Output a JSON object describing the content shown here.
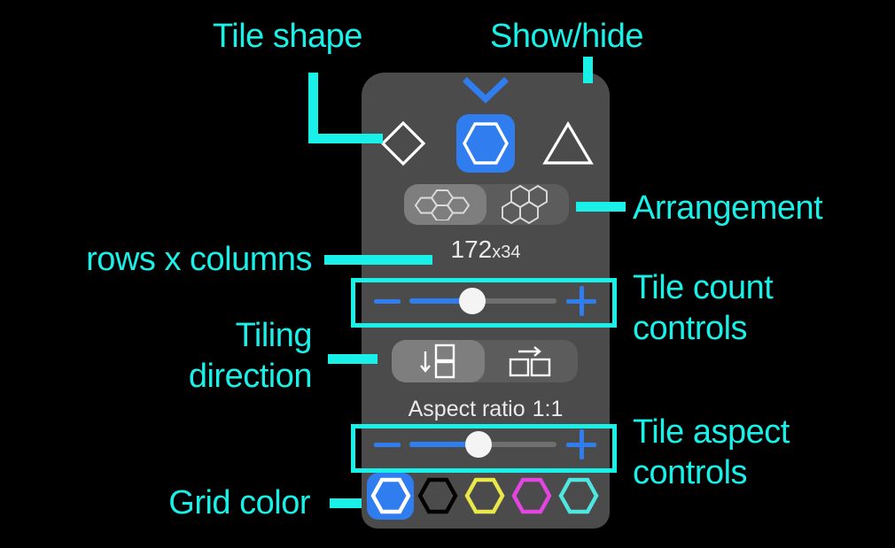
{
  "theme": {
    "background": "#000000",
    "panel_bg": "#4b4b4b",
    "segment_bg": "#5c5c5c",
    "segment_selected_bg": "#7e7e7e",
    "accent_blue": "#2f7def",
    "annotation_cyan": "#18f0e8",
    "text_white": "#e9e9e9"
  },
  "annotations": [
    {
      "id": "tile-shape",
      "label": "Tile shape"
    },
    {
      "id": "show-hide",
      "label": "Show/hide"
    },
    {
      "id": "arrangement",
      "label": "Arrangement"
    },
    {
      "id": "rows-columns",
      "label": "rows x columns"
    },
    {
      "id": "tile-count",
      "label": "Tile count\ncontrols"
    },
    {
      "id": "tiling-dir",
      "label": "Tiling\ndirection"
    },
    {
      "id": "tile-aspect",
      "label": "Tile aspect\ncontrols"
    },
    {
      "id": "grid-color",
      "label": "Grid color"
    }
  ],
  "panel": {
    "collapse_toggle": {
      "icon": "chevron-down-icon",
      "color": "#2f7def"
    },
    "tile_shape": {
      "options": [
        {
          "id": "diamond",
          "icon": "diamond-shape-icon",
          "selected": false
        },
        {
          "id": "hexagon",
          "icon": "hexagon-shape-icon",
          "selected": true
        },
        {
          "id": "triangle",
          "icon": "triangle-shape-icon",
          "selected": false
        }
      ]
    },
    "arrangement": {
      "options": [
        {
          "id": "flat-top",
          "icon": "hex-cluster-flat-icon",
          "selected": true
        },
        {
          "id": "pointy-top",
          "icon": "hex-cluster-pointy-icon",
          "selected": false
        }
      ]
    },
    "tile_count": {
      "value_label": "172",
      "value_sub_label": "x34",
      "rows": 172,
      "columns": 34,
      "slider": {
        "percent": 43,
        "minus_icon": "minus-icon",
        "plus_icon": "plus-icon"
      }
    },
    "tiling_direction": {
      "options": [
        {
          "id": "vertical",
          "icon": "arrow-down-stacked-squares-icon",
          "selected": true
        },
        {
          "id": "horizontal",
          "icon": "arrow-right-side-squares-icon",
          "selected": false
        }
      ]
    },
    "tile_aspect": {
      "label": "Aspect ratio",
      "value": "1:1",
      "slider": {
        "percent": 47,
        "minus_icon": "minus-icon",
        "plus_icon": "plus-icon"
      }
    },
    "grid_color": {
      "swatches": [
        {
          "id": "blue",
          "color": "#2f7def",
          "outline": "#ffffff",
          "selected": true
        },
        {
          "id": "black",
          "color": "#000000",
          "outline": "#000000",
          "selected": false
        },
        {
          "id": "yellow",
          "color": "#e8e84a",
          "outline": "#e8e84a",
          "selected": false
        },
        {
          "id": "magenta",
          "color": "#e146e1",
          "outline": "#e146e1",
          "selected": false
        },
        {
          "id": "cyan",
          "color": "#4fe8e0",
          "outline": "#4fe8e0",
          "selected": false
        }
      ]
    }
  }
}
